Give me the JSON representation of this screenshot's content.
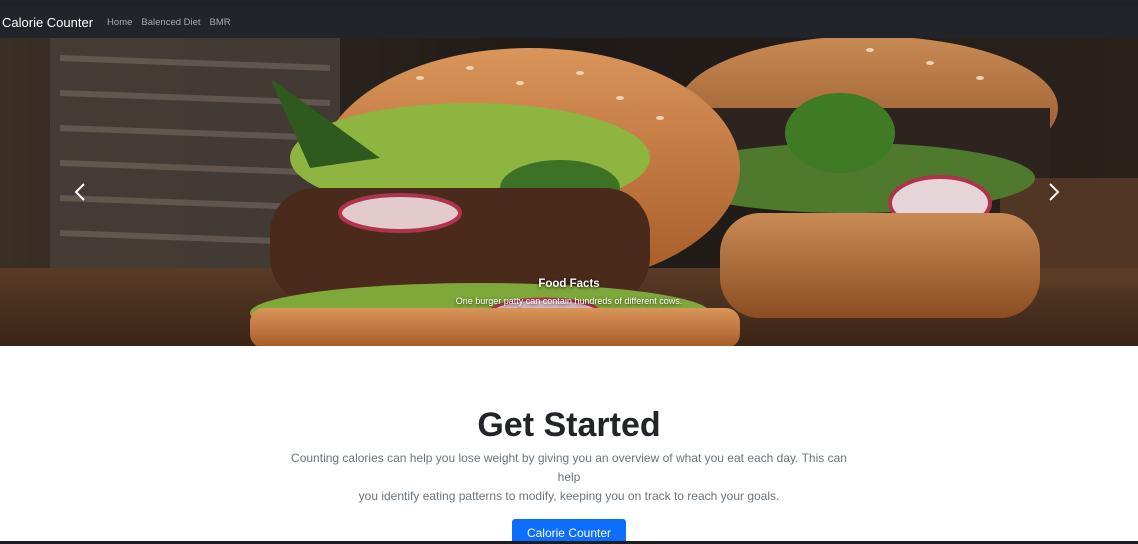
{
  "navbar": {
    "brand": "Calorie Counter",
    "links": [
      "Home",
      "Balenced Diet",
      "BMR"
    ]
  },
  "carousel": {
    "caption_title": "Food Facts",
    "caption_text": "One burger patty can contain hundreds of different cows.",
    "prev_icon": "chevron-left-icon",
    "next_icon": "chevron-right-icon"
  },
  "main": {
    "title": "Get Started",
    "lead_line1": "Counting calories can help you lose weight by giving you an overview of what you eat each day. This can help",
    "lead_line2": "you identify eating patterns to modify, keeping you on track to reach your goals.",
    "button_label": "Calorie Counter"
  },
  "colors": {
    "navbar_bg": "#212529",
    "primary": "#0d6efd",
    "title_text": "#212529",
    "lead_text": "#6c757d"
  }
}
